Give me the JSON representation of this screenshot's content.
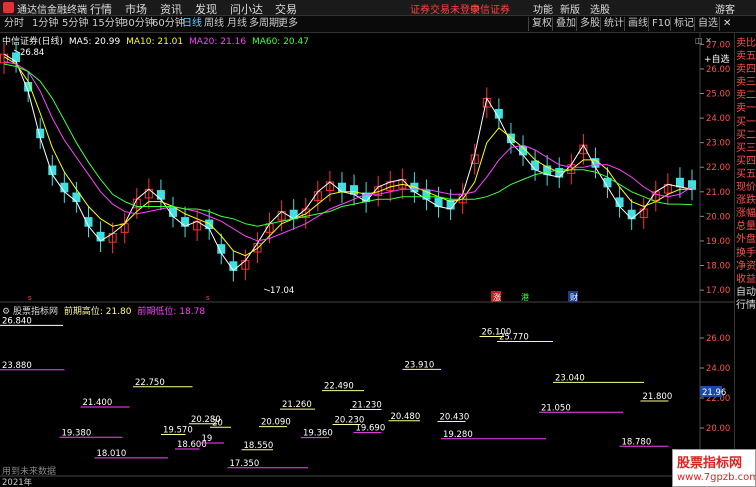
{
  "menubar": {
    "app_title": "通达信金融终端",
    "menus": [
      "行情",
      "市场",
      "资讯",
      "发现",
      "问小达",
      "交易"
    ],
    "login_status": "证券交易未登录",
    "broker": "中信证券",
    "right_menus": [
      "功能",
      "新版",
      "选股",
      "游客"
    ]
  },
  "toolbar": {
    "periods": [
      "分时",
      "1分钟",
      "5分钟",
      "15分钟",
      "30分钟",
      "60分钟",
      "日线",
      "周线",
      "月线",
      "多周期",
      "更多"
    ],
    "active_period": "日线",
    "right_buttons": [
      "复权",
      "叠加",
      "多股",
      "统计",
      "画线",
      "F10",
      "标记",
      "自选"
    ]
  },
  "stock": {
    "name": "中信证券(日线)",
    "ma5": "MA5: 20.99",
    "ma10": "MA10: 21.01",
    "ma20": "MA20: 21.16",
    "ma60": "MA60: 20.47",
    "high_label": "26.84",
    "low_label": "17.04",
    "add_watch": "+自选"
  },
  "indicator": {
    "title": "股票指标网",
    "high_label": "前期高位: 21.80",
    "low_label": "前期低位: 18.78",
    "current_price": "21.96"
  },
  "side_panel": {
    "items": [
      "卖比",
      "卖五",
      "卖四",
      "卖三",
      "卖二",
      "卖一",
      "买一",
      "买二",
      "买三",
      "买四",
      "买五",
      "现价",
      "涨跌",
      "涨幅",
      "总量",
      "外盘",
      "换手",
      "净资",
      "收益",
      "自动",
      "行情"
    ],
    "badge": "L"
  },
  "watermark": {
    "main": "股票指标网",
    "sub": "www.7gpzb.com"
  },
  "bottom": {
    "note": "用到未来数据",
    "year_label": "2021年"
  },
  "colors": {
    "up": "#ff3030",
    "down": "#40e0e0",
    "ma5": "#ffffff",
    "ma10": "#ffff00",
    "ma20": "#ff40ff",
    "ma60": "#40ff40"
  },
  "chart_data": {
    "type": "line",
    "title": "中信证券(日线)",
    "ylim": [
      16.8,
      27.3
    ],
    "yticks": [
      "27.00",
      "26.00",
      "25.00",
      "24.00",
      "23.00",
      "22.00",
      "21.00",
      "20.00",
      "19.00",
      "18.00",
      "17.00"
    ],
    "series": [
      {
        "name": "MA5",
        "values": [
          26.6,
          26.3,
          25.1,
          23.2,
          21.7,
          21.0,
          20.6,
          19.6,
          19.0,
          19.3,
          19.7,
          20.7,
          21.1,
          20.7,
          20.0,
          19.6,
          19.8,
          19.5,
          18.5,
          17.8,
          18.2,
          18.9,
          19.7,
          20.2,
          19.9,
          20.3,
          21.0,
          21.4,
          21.0,
          20.9,
          20.6,
          21.2,
          21.4,
          21.5,
          21.0,
          20.7,
          20.4,
          20.3,
          20.9,
          22.5,
          24.8,
          24.0,
          23.0,
          22.5,
          21.9,
          21.7,
          21.6,
          22.1,
          22.9,
          22.0,
          21.2,
          20.4,
          19.9,
          20.3,
          21.0,
          21.3,
          21.2,
          21.1
        ]
      },
      {
        "name": "MA10",
        "values": [
          26.5,
          26.2,
          25.5,
          24.2,
          22.8,
          21.8,
          21.1,
          20.4,
          19.9,
          19.6,
          19.7,
          20.2,
          20.6,
          20.6,
          20.4,
          20.1,
          19.9,
          19.7,
          19.2,
          18.6,
          18.4,
          18.7,
          19.2,
          19.7,
          19.9,
          20.1,
          20.5,
          20.9,
          21.0,
          21.0,
          20.9,
          21.0,
          21.2,
          21.3,
          21.2,
          21.0,
          20.8,
          20.6,
          20.7,
          21.4,
          23.0,
          23.6,
          23.2,
          22.8,
          22.3,
          22.0,
          21.8,
          21.9,
          22.3,
          22.3,
          21.9,
          21.2,
          20.6,
          20.4,
          20.6,
          20.9,
          21.1,
          21.1
        ]
      },
      {
        "name": "MA20",
        "values": [
          26.3,
          26.2,
          25.9,
          25.1,
          24.0,
          23.1,
          22.4,
          21.7,
          21.0,
          20.5,
          20.2,
          20.1,
          20.2,
          20.3,
          20.4,
          20.3,
          20.2,
          20.0,
          19.8,
          19.5,
          19.2,
          19.0,
          19.1,
          19.3,
          19.5,
          19.7,
          20.0,
          20.3,
          20.5,
          20.7,
          20.9,
          20.9,
          21.0,
          21.1,
          21.1,
          21.1,
          21.0,
          20.9,
          20.9,
          21.0,
          21.6,
          22.3,
          22.8,
          22.9,
          22.7,
          22.4,
          22.1,
          22.0,
          22.0,
          22.1,
          22.1,
          21.9,
          21.6,
          21.2,
          20.9,
          20.8,
          20.9,
          21.2
        ]
      },
      {
        "name": "MA60",
        "values": [
          26.2,
          26.1,
          25.9,
          25.5,
          24.8,
          23.9,
          23.0,
          22.2,
          21.5,
          20.9,
          20.6,
          20.4,
          20.4,
          20.4,
          20.4,
          20.3,
          20.3,
          20.2,
          20.0,
          19.9,
          19.7,
          19.6,
          19.7,
          19.8,
          19.9,
          20.0,
          20.1,
          20.2,
          20.4,
          20.5,
          20.6,
          20.7,
          20.7,
          20.8,
          20.8,
          20.8,
          20.8,
          20.7,
          20.7,
          20.7,
          20.8,
          21.0,
          21.3,
          21.5,
          21.7,
          21.8,
          21.9,
          21.9,
          21.9,
          21.8,
          21.6,
          21.3,
          21.0,
          20.8,
          20.6,
          20.5,
          20.5,
          20.47
        ]
      }
    ],
    "indicator": {
      "ylim": [
        17.0,
        27.0
      ],
      "yticks": [
        "26.00",
        "24.00",
        "22.00",
        "20.00"
      ],
      "current_price": 21.96,
      "levels": [
        {
          "label": "26.840",
          "value": 26.84,
          "color": "#ffffff",
          "x0": 0.0,
          "x1": 0.09
        },
        {
          "label": "23.880",
          "value": 23.88,
          "color": "#ff40ff",
          "x0": 0.0,
          "x1": 0.092
        },
        {
          "label": "22.750",
          "value": 22.75,
          "color": "#ffff88",
          "x0": 0.19,
          "x1": 0.275
        },
        {
          "label": "21.400",
          "value": 21.4,
          "color": "#ff40ff",
          "x0": 0.115,
          "x1": 0.185
        },
        {
          "label": "19.380",
          "value": 19.38,
          "color": "#ff40ff",
          "x0": 0.085,
          "x1": 0.175
        },
        {
          "label": "18.010",
          "value": 18.01,
          "color": "#ff40ff",
          "x0": 0.135,
          "x1": 0.24
        },
        {
          "label": "19.570",
          "value": 19.57,
          "color": "#ffff88",
          "x0": 0.23,
          "x1": 0.265
        },
        {
          "label": "18.600",
          "value": 18.6,
          "color": "#ff40ff",
          "x0": 0.25,
          "x1": 0.285
        },
        {
          "label": "20.280",
          "value": 20.28,
          "color": "#ffff88",
          "x0": 0.27,
          "x1": 0.31
        },
        {
          "label": "20",
          "value": 20.05,
          "color": "#ffff88",
          "x0": 0.3,
          "x1": 0.33
        },
        {
          "label": "19",
          "value": 19.0,
          "color": "#ff40ff",
          "x0": 0.285,
          "x1": 0.32
        },
        {
          "label": "17.350",
          "value": 17.35,
          "color": "#ff40ff",
          "x0": 0.325,
          "x1": 0.44
        },
        {
          "label": "18.550",
          "value": 18.55,
          "color": "#ffff88",
          "x0": 0.345,
          "x1": 0.39
        },
        {
          "label": "20.090",
          "value": 20.09,
          "color": "#ffff88",
          "x0": 0.37,
          "x1": 0.41
        },
        {
          "label": "21.260",
          "value": 21.26,
          "color": "#ffff88",
          "x0": 0.4,
          "x1": 0.45
        },
        {
          "label": "19.360",
          "value": 19.36,
          "color": "#ff40ff",
          "x0": 0.43,
          "x1": 0.47
        },
        {
          "label": "22.490",
          "value": 22.49,
          "color": "#ffff88",
          "x0": 0.46,
          "x1": 0.52
        },
        {
          "label": "20.230",
          "value": 20.23,
          "color": "#ffff88",
          "x0": 0.475,
          "x1": 0.515
        },
        {
          "label": "19.690",
          "value": 19.69,
          "color": "#ff40ff",
          "x0": 0.505,
          "x1": 0.545
        },
        {
          "label": "21.230",
          "value": 21.23,
          "color": "#ffff88",
          "x0": 0.5,
          "x1": 0.545
        },
        {
          "label": "20.480",
          "value": 20.48,
          "color": "#ffff88",
          "x0": 0.555,
          "x1": 0.6
        },
        {
          "label": "23.910",
          "value": 23.91,
          "color": "#ffff88",
          "x0": 0.575,
          "x1": 0.63
        },
        {
          "label": "20.430",
          "value": 20.43,
          "color": "#ffff88",
          "x0": 0.625,
          "x1": 0.665
        },
        {
          "label": "19.280",
          "value": 19.28,
          "color": "#ff40ff",
          "x0": 0.63,
          "x1": 0.78
        },
        {
          "label": "26.100",
          "value": 26.1,
          "color": "#ffff88",
          "x0": 0.685,
          "x1": 0.72
        },
        {
          "label": "25.770",
          "value": 25.77,
          "color": "#ffff88",
          "x0": 0.71,
          "x1": 0.79
        },
        {
          "label": "23.040",
          "value": 23.04,
          "color": "#ffff88",
          "x0": 0.79,
          "x1": 0.92
        },
        {
          "label": "21.050",
          "value": 21.05,
          "color": "#ff40ff",
          "x0": 0.77,
          "x1": 0.89
        },
        {
          "label": "21.800",
          "value": 21.8,
          "color": "#ffff88",
          "x0": 0.915,
          "x1": 0.955
        },
        {
          "label": "18.780",
          "value": 18.78,
          "color": "#ff40ff",
          "x0": 0.885,
          "x1": 0.955
        }
      ]
    }
  }
}
